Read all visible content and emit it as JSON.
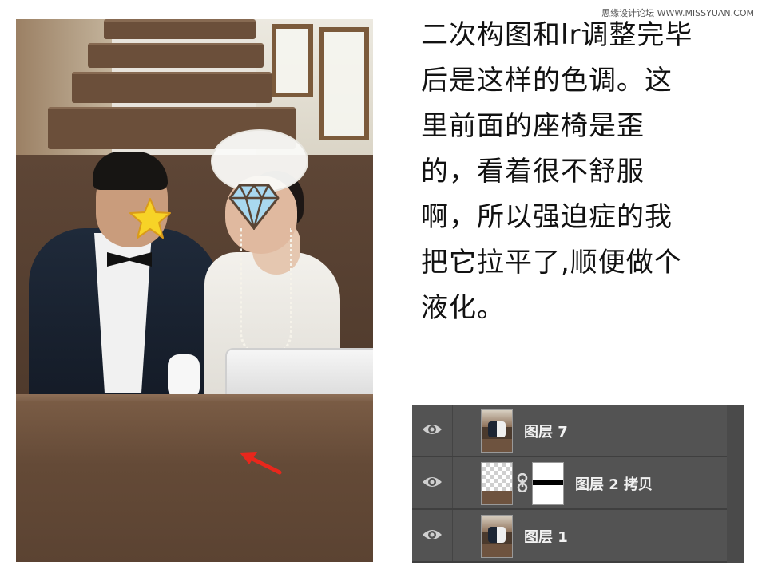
{
  "watermark": "思缘设计论坛 WWW.MISSYUAN.COM",
  "description": {
    "lines": [
      "二次构图和lr调整完毕",
      "后是这样的色调。这",
      "里前面的座椅是歪",
      "的，看着很不舒服",
      "啊，所以强迫症的我",
      "把它拉平了,顺便做个",
      "液化。"
    ]
  },
  "photo": {
    "icons": [
      "star-icon",
      "diamond-icon",
      "arrow-icon"
    ],
    "colors": {
      "arrow": "#e8271c",
      "star": "#f7d327",
      "diamond": "#a9d8ef"
    }
  },
  "layers_panel": {
    "colors": {
      "background": "#535353",
      "text": "#f2f2f2"
    },
    "layers": [
      {
        "name": "图层 7",
        "visible": true,
        "icon": "eye-icon"
      },
      {
        "name": "图层 2 拷贝",
        "visible": true,
        "icon": "eye-icon",
        "has_mask": true
      },
      {
        "name": "图层 1",
        "visible": true,
        "icon": "eye-icon"
      }
    ]
  }
}
